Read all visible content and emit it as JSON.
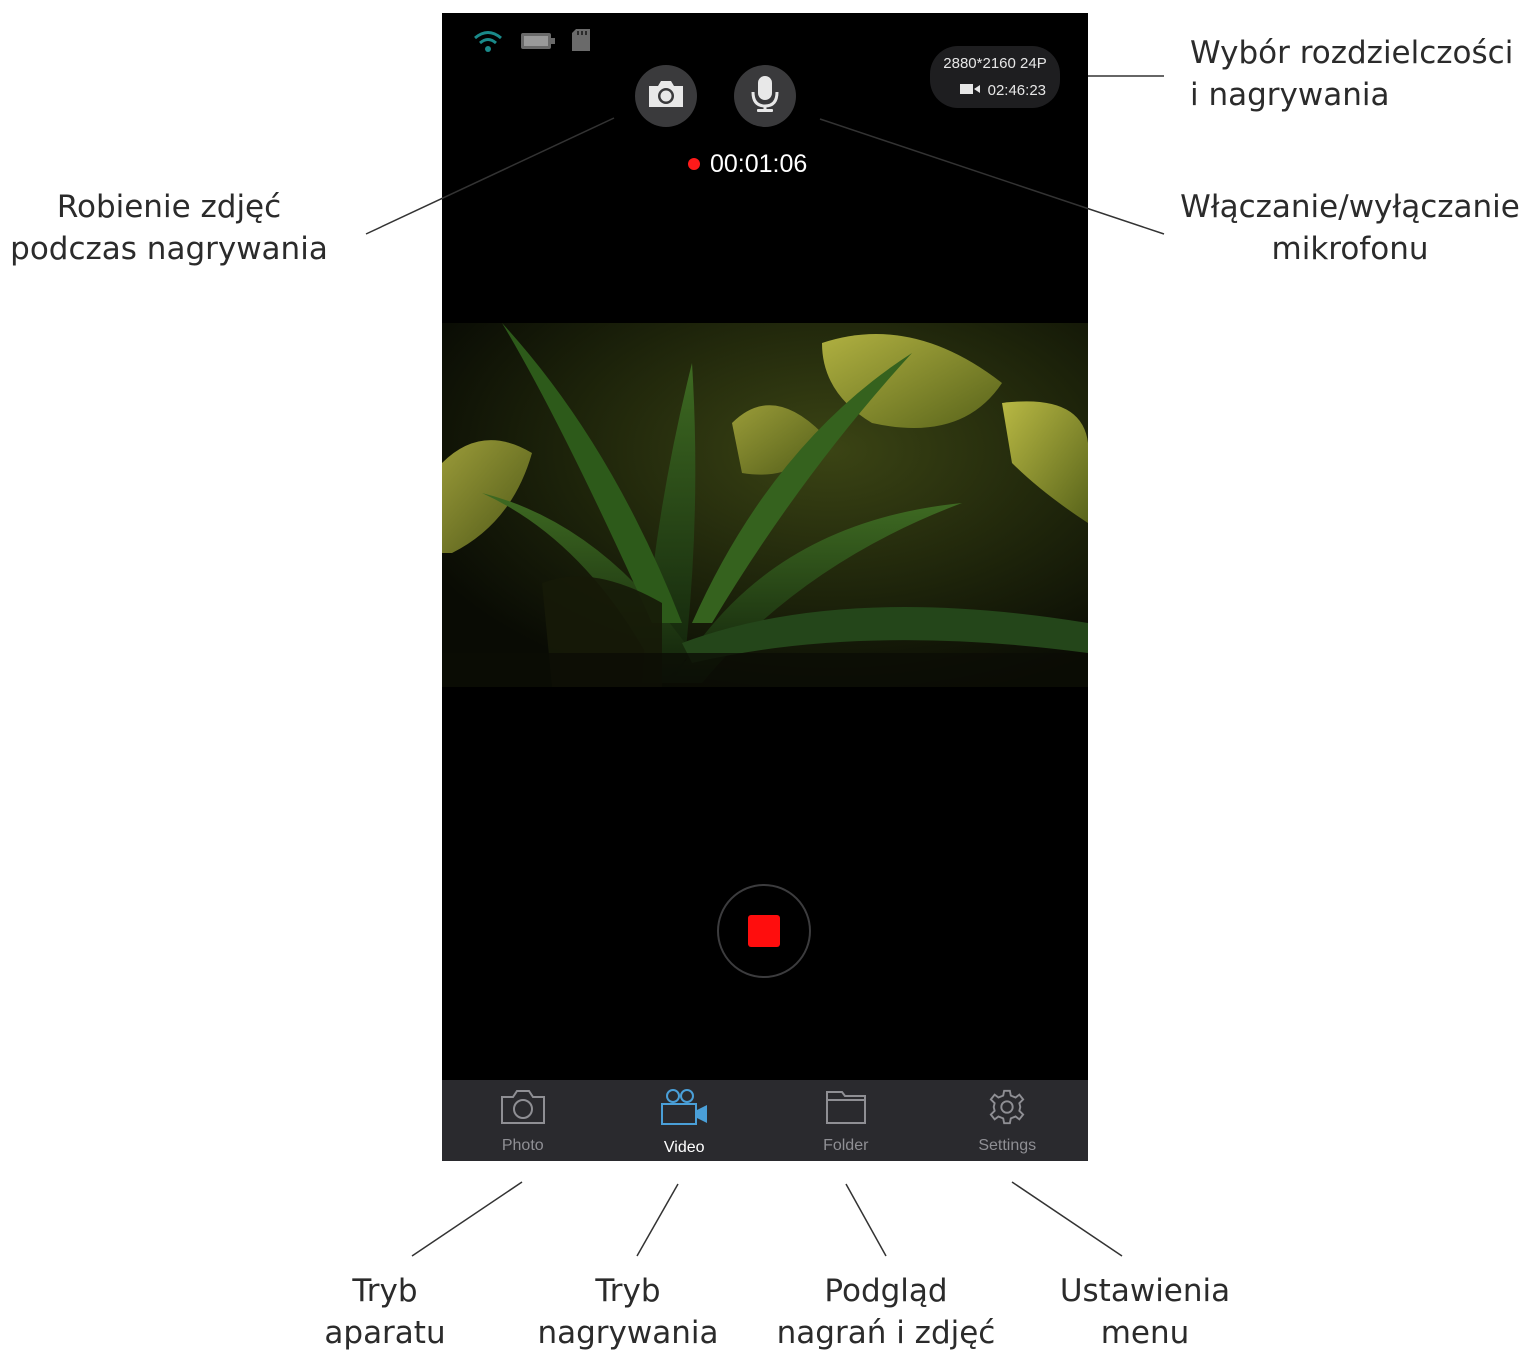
{
  "status_bar": {
    "icons": [
      "wifi-icon",
      "battery-icon",
      "sd-card-icon"
    ]
  },
  "top_controls": {
    "photo_icon": "camera-icon",
    "mic_icon": "microphone-icon"
  },
  "resolution": {
    "mode": "2880*2160 24P",
    "remaining": "02:46:23",
    "icon": "video-camera-icon"
  },
  "recording": {
    "time": "00:01:06",
    "color": "#ff1a1a"
  },
  "tabs": [
    {
      "label": "Photo",
      "icon": "camera-icon",
      "active": false
    },
    {
      "label": "Video",
      "icon": "video-camera-icon",
      "active": true
    },
    {
      "label": "Folder",
      "icon": "folder-icon",
      "active": false
    },
    {
      "label": "Settings",
      "icon": "gear-icon",
      "active": false
    }
  ],
  "annotations": {
    "resolution": [
      "Wybór rozdzielczości",
      "i nagrywania"
    ],
    "photo_during_recording": [
      "Robienie zdjęć",
      "podczas nagrywania"
    ],
    "microphone": [
      "Włączanie/wyłączanie",
      "mikrofonu"
    ],
    "photo_mode": [
      "Tryb",
      "aparatu"
    ],
    "video_mode": [
      "Tryb",
      "nagrywania"
    ],
    "gallery": [
      "Podgląd",
      "nagrań i zdjęć"
    ],
    "settings": [
      "Ustawienia",
      "menu"
    ]
  },
  "colors": {
    "accent": "#4a9fd8",
    "record": "#ff0d0d",
    "wifi": "#1a8a8a"
  }
}
